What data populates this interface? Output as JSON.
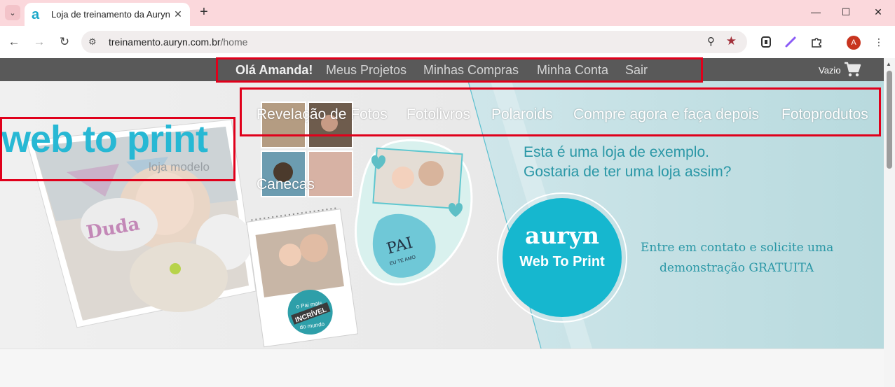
{
  "browser": {
    "tab_title": "Loja de treinamento da Auryn",
    "tab_favicon": "a",
    "url_host": "treinamento.auryn.com.br",
    "url_path": "/home",
    "profile_initial": "A"
  },
  "topnav": {
    "greeting": "Olá Amanda!",
    "projects": "Meus Projetos",
    "purchases": "Minhas Compras",
    "account": "Minha Conta",
    "logout": "Sair",
    "cart_label": "Vazio"
  },
  "mainnav": {
    "items": [
      "Revelação de Fotos",
      "Fotolivros",
      "Polaroids",
      "Compre agora e faça depois",
      "Fotoprodutos"
    ],
    "second_row": "Canecas"
  },
  "logo": {
    "text": "web to print",
    "subtitle": "loja modelo"
  },
  "banner": {
    "message_line1": "Esta é uma loja de exemplo.",
    "message_line2": "Gostaria de ter uma loja assim?",
    "brand": "auryn",
    "brand_sub": "Web To Print",
    "cta_line1": "Entre em contato e solicite uma",
    "cta_line2": "demonstração GRATUITA",
    "book_name": "Duda",
    "notebook_text": "o Pai mais INCRÍVEL do mundo",
    "heart_text": "PAI",
    "heart_sub": "EU TE AMO"
  },
  "colors": {
    "tabbar": "#fbd8dc",
    "topnav": "#595959",
    "accent": "#16b7cf",
    "text_teal": "#2a97a6",
    "highlight": "#e0001b"
  }
}
